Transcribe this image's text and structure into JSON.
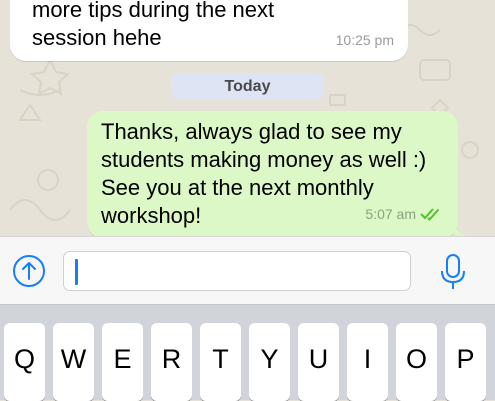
{
  "messages": {
    "incoming": {
      "text": "more tips during the next session hehe",
      "time": "10:25 pm"
    },
    "date_separator": "Today",
    "outgoing": {
      "text": "Thanks, always glad to see my students making money as well :) See you at the next monthly workshop!",
      "time": "5:07 am",
      "status_icon": "double-check-icon"
    }
  },
  "input_bar": {
    "upload_icon": "upload-arrow-icon",
    "input_value": "",
    "input_placeholder": "",
    "mic_icon": "microphone-icon"
  },
  "keyboard": {
    "row1": [
      "Q",
      "W",
      "E",
      "R",
      "T",
      "Y",
      "U",
      "I",
      "O",
      "P"
    ]
  },
  "colors": {
    "outgoing_bubble": "#dcf8c6",
    "incoming_bubble": "#ffffff",
    "date_pill": "#dfe4f5",
    "accent_blue": "#157efb",
    "read_receipt": "#4fc32c"
  }
}
